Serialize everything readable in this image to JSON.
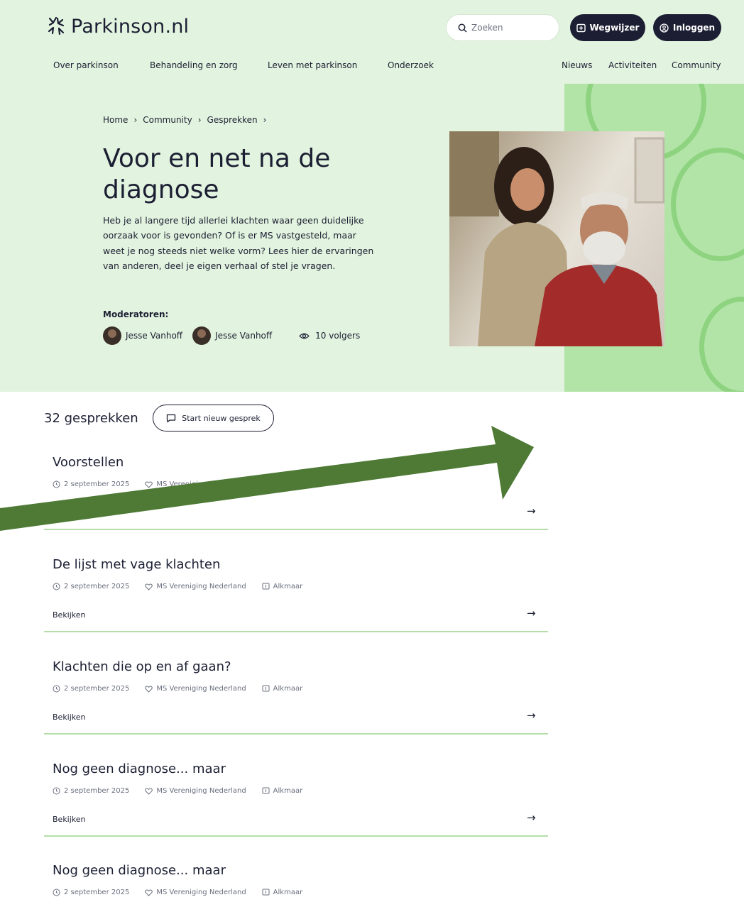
{
  "site": {
    "logo_text": "Parkinson.nl"
  },
  "header": {
    "search_placeholder": "Zoeken",
    "wegwijzer_label": "Wegwijzer",
    "login_label": "Inloggen"
  },
  "nav": {
    "primary": [
      "Over parkinson",
      "Behandeling en zorg",
      "Leven met parkinson",
      "Onderzoek"
    ],
    "secondary": [
      "Nieuws",
      "Activiteiten",
      "Community"
    ]
  },
  "breadcrumb": [
    "Home",
    "Community",
    "Gesprekken"
  ],
  "hero": {
    "title": "Voor en net na de diagnose",
    "intro": "Heb je al langere tijd allerlei klachten waar geen duidelijke oorzaak voor is gevonden? Of is er MS vastgesteld, maar weet je nog steeds niet welke vorm? Lees hier de ervaringen van anderen, deel je eigen verhaal of stel je vragen.",
    "moderators_label": "Moderatoren:",
    "moderators": [
      "Jesse Vanhoff",
      "Jesse Vanhoff"
    ],
    "followers": "10 volgers"
  },
  "conversations": {
    "count_label": "32 gesprekken",
    "new_button": "Start nieuw gesprek",
    "items": [
      {
        "title": "Voorstellen",
        "date": "2 september 2025",
        "org": "MS Vereniging Nederland",
        "location": "",
        "link": ""
      },
      {
        "title": "De lijst met vage klachten",
        "date": "2 september 2025",
        "org": "MS Vereniging Nederland",
        "location": "Alkmaar",
        "link": "Bekijken"
      },
      {
        "title": "Klachten die op en af gaan?",
        "date": "2 september 2025",
        "org": "MS Vereniging Nederland",
        "location": "Alkmaar",
        "link": "Bekijken"
      },
      {
        "title": "Nog geen diagnose... maar",
        "date": "2 september 2025",
        "org": "MS Vereniging Nederland",
        "location": "Alkmaar",
        "link": "Bekijken"
      },
      {
        "title": "Nog geen diagnose... maar",
        "date": "2 september 2025",
        "org": "MS Vereniging Nederland",
        "location": "Alkmaar",
        "link": ""
      }
    ]
  },
  "colors": {
    "hero_bg": "#e2f3df",
    "deco_green": "#b2e4a8",
    "dark": "#1c1f33",
    "divider": "#b5dfa8",
    "annotation_arrow": "#4e7a35"
  }
}
